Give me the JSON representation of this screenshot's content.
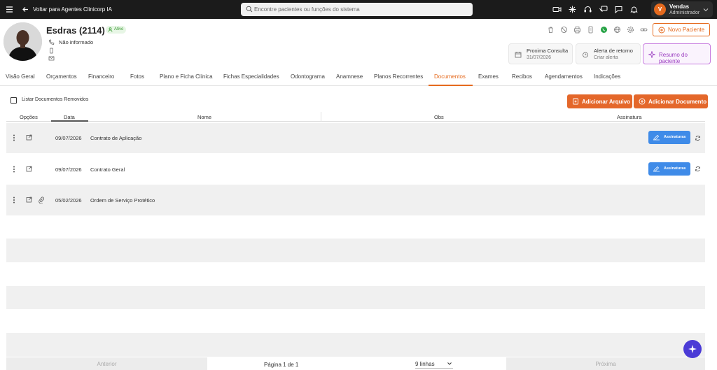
{
  "topbar": {
    "back_label": "Voltar para Agentes Clinicorp IA",
    "search_placeholder": "Encontre pacientes ou funções do sistema",
    "user_initial": "V",
    "user_name": "Vendas",
    "user_role": "Administrador"
  },
  "patient": {
    "name": "Esdras (2114)",
    "status": "Ativo",
    "phone": "Não informado"
  },
  "header_actions": {
    "new_patient": "Novo Paciente"
  },
  "cards": {
    "next_title": "Proxima Consulta",
    "next_value": "31/07/2026",
    "alert_title": "Alerta de retorno",
    "alert_value": "Criar alerta",
    "summary": "Resumo do paciente"
  },
  "tabs": [
    "Visão Geral",
    "Orçamentos",
    "Financeiro",
    "Fotos",
    "Plano e Ficha Clínica",
    "Fichas Especialidades",
    "Odontograma",
    "Anamnese",
    "Planos Recorrentes",
    "Documentos",
    "Exames",
    "Recibos",
    "Agendamentos",
    "Indicações"
  ],
  "active_tab": "Documentos",
  "toolbar": {
    "show_removed": "Listar Documentos Removidos",
    "add_file": "Adicionar Arquivo",
    "add_document": "Adicionar Documento"
  },
  "table": {
    "headers": [
      "Opções",
      "Data",
      "Nome",
      "Obs",
      "Assinatura"
    ],
    "rows": [
      {
        "date": "09/07/2026",
        "name": "Contrato de Aplicação",
        "signatures": "Assinaturas"
      },
      {
        "date": "09/07/2026",
        "name": "Contrato Geral",
        "signatures": "Assinaturas"
      },
      {
        "date": "05/02/2026",
        "name": "Ordem de Serviço Protético",
        "signatures": ""
      }
    ]
  },
  "pager": {
    "prev": "Anterior",
    "page": "Página 1 de 1",
    "rows": "9 linhas",
    "next": "Próxima"
  },
  "colors": {
    "accent": "#e56a1e",
    "signature_button": "#3f8be8",
    "status_green": "#3a9a34",
    "fab": "#4b3bd6"
  }
}
